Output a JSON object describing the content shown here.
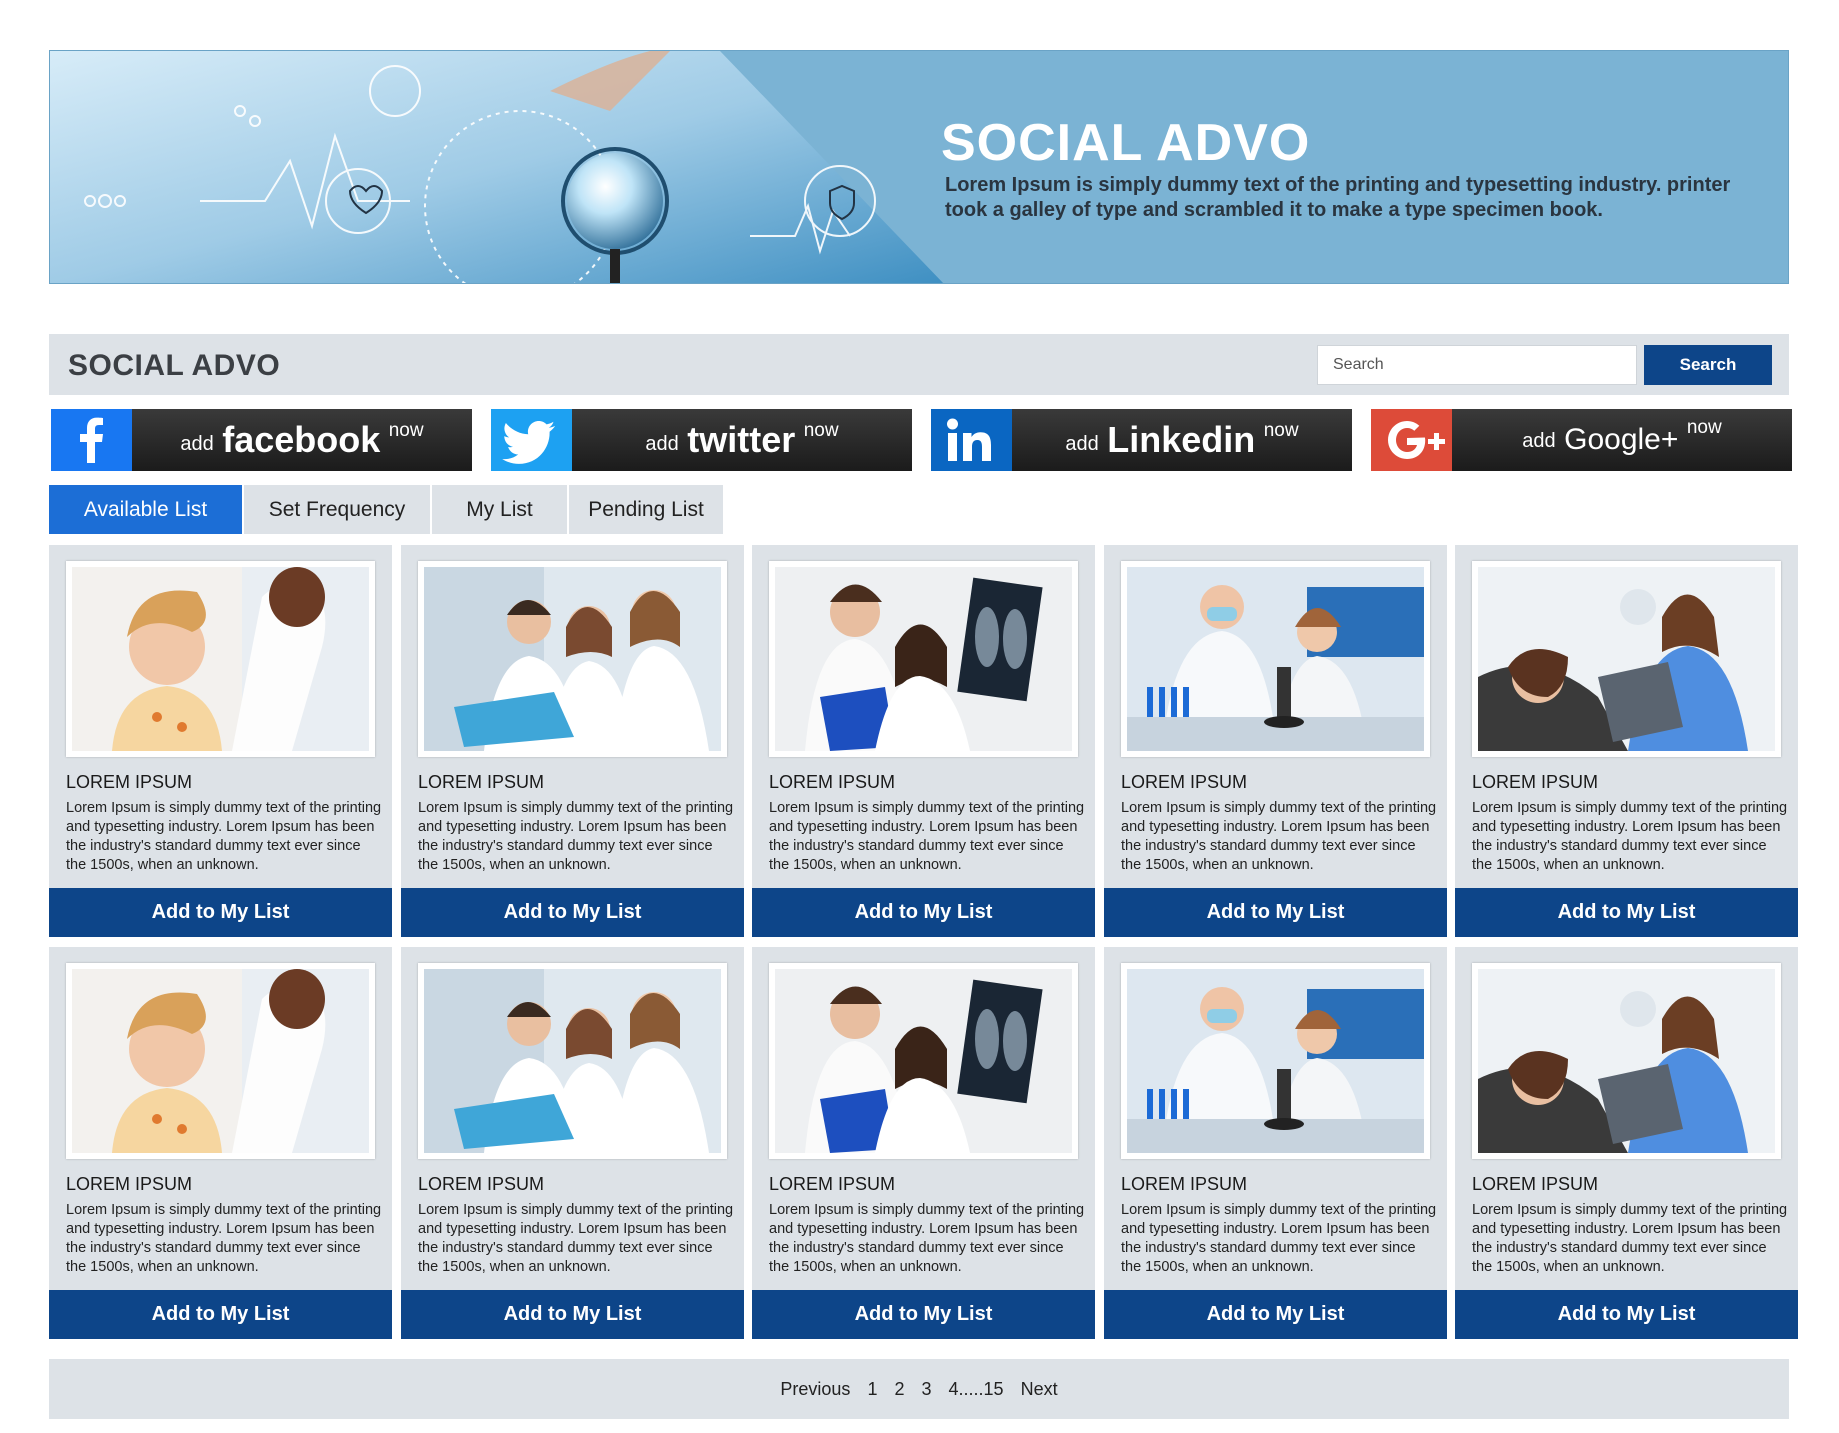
{
  "banner": {
    "title": "SOCIAL ADVO",
    "description": "Lorem Ipsum is simply dummy text of the printing and typesetting industry. printer took a galley of type and scrambled it to make a type specimen book."
  },
  "header": {
    "brand": "SOCIAL ADVO",
    "search_placeholder": "Search",
    "search_button": "Search"
  },
  "social": [
    {
      "add": "add",
      "brand": "facebook",
      "now": "now",
      "icon": "facebook-icon",
      "color": "#1877f2"
    },
    {
      "add": "add",
      "brand": "twitter",
      "now": "now",
      "icon": "twitter-icon",
      "color": "#1da1f2"
    },
    {
      "add": "add",
      "brand": "Linkedin",
      "now": "now",
      "icon": "linkedin-icon",
      "color": "#0a66c2"
    },
    {
      "add": "add",
      "brand": "Google+",
      "now": "now",
      "icon": "google-plus-icon",
      "color": "#dd4b39"
    }
  ],
  "tabs": [
    {
      "label": "Available List",
      "active": true
    },
    {
      "label": "Set Frequency",
      "active": false
    },
    {
      "label": "My List",
      "active": false
    },
    {
      "label": "Pending List",
      "active": false
    }
  ],
  "cards": [
    {
      "title": "LOREM IPSUM",
      "text": "Lorem Ipsum is simply dummy text of the printing and typesetting industry. Lorem Ipsum has been the industry's standard dummy text ever since the 1500s, when an unknown.",
      "button": "Add to My List",
      "image": "doctor-child-photo"
    },
    {
      "title": "LOREM IPSUM",
      "text": "Lorem Ipsum is simply dummy text of the printing and typesetting industry. Lorem Ipsum has been the industry's standard dummy text ever since the 1500s, when an unknown.",
      "button": "Add to My List",
      "image": "medical-team-photo"
    },
    {
      "title": "LOREM IPSUM",
      "text": "Lorem Ipsum is simply dummy text of the printing and typesetting industry. Lorem Ipsum has been the industry's standard dummy text ever since the 1500s, when an unknown.",
      "button": "Add to My List",
      "image": "xray-doctors-photo"
    },
    {
      "title": "LOREM IPSUM",
      "text": "Lorem Ipsum is simply dummy text of the printing and typesetting industry. Lorem Ipsum has been the industry's standard dummy text ever since the 1500s, when an unknown.",
      "button": "Add to My List",
      "image": "lab-scientists-photo"
    },
    {
      "title": "LOREM IPSUM",
      "text": "Lorem Ipsum is simply dummy text of the printing and typesetting industry. Lorem Ipsum has been the industry's standard dummy text ever since the 1500s, when an unknown.",
      "button": "Add to My List",
      "image": "dentist-patient-photo"
    },
    {
      "title": "LOREM IPSUM",
      "text": "Lorem Ipsum is simply dummy text of the printing and typesetting industry. Lorem Ipsum has been the industry's standard dummy text ever since the 1500s, when an unknown.",
      "button": "Add to My List",
      "image": "doctor-child-photo"
    },
    {
      "title": "LOREM IPSUM",
      "text": "Lorem Ipsum is simply dummy text of the printing and typesetting industry. Lorem Ipsum has been the industry's standard dummy text ever since the 1500s, when an unknown.",
      "button": "Add to My List",
      "image": "medical-team-photo"
    },
    {
      "title": "LOREM IPSUM",
      "text": "Lorem Ipsum is simply dummy text of the printing and typesetting industry. Lorem Ipsum has been the industry's standard dummy text ever since the 1500s, when an unknown.",
      "button": "Add to My List",
      "image": "xray-doctors-photo"
    },
    {
      "title": "LOREM IPSUM",
      "text": "Lorem Ipsum is simply dummy text of the printing and typesetting industry. Lorem Ipsum has been the industry's standard dummy text ever since the 1500s, when an unknown.",
      "button": "Add to My List",
      "image": "lab-scientists-photo"
    },
    {
      "title": "LOREM IPSUM",
      "text": "Lorem Ipsum is simply dummy text of the printing and typesetting industry. Lorem Ipsum has been the industry's standard dummy text ever since the 1500s, when an unknown.",
      "button": "Add to My List",
      "image": "dentist-patient-photo"
    }
  ],
  "pagination": {
    "previous": "Previous",
    "pages": [
      "1",
      "2",
      "3",
      "4.....15"
    ],
    "next": "Next"
  }
}
